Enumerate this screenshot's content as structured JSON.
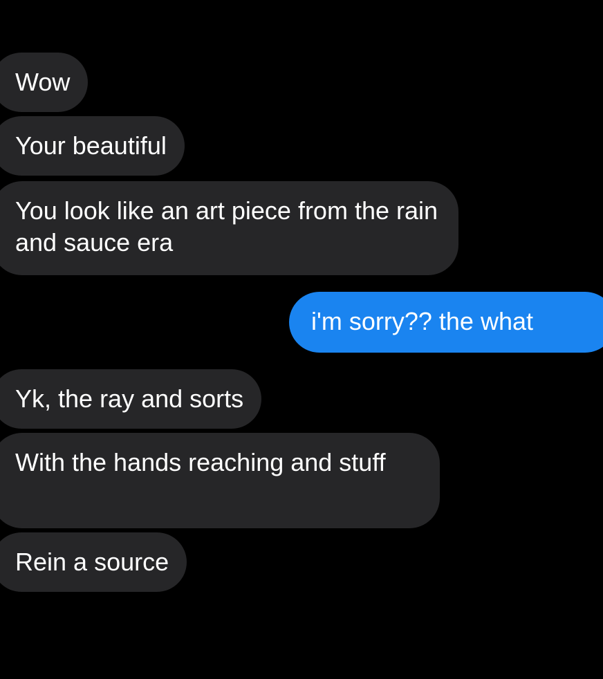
{
  "conversation": {
    "messages": [
      {
        "sender": "them",
        "text": "Wow"
      },
      {
        "sender": "them",
        "text": "Your beautiful"
      },
      {
        "sender": "them",
        "text": "You look like an art piece from the rain and sauce era"
      },
      {
        "sender": "me",
        "text": "i'm sorry?? the what"
      },
      {
        "sender": "them",
        "text": "Yk, the ray and sorts"
      },
      {
        "sender": "them",
        "text": "With the hands reaching and stuff"
      },
      {
        "sender": "them",
        "text": "Rein a source"
      }
    ]
  },
  "colors": {
    "background": "#000000",
    "incoming_bubble": "#262628",
    "outgoing_bubble": "#1a84f0",
    "text": "#ffffff"
  }
}
